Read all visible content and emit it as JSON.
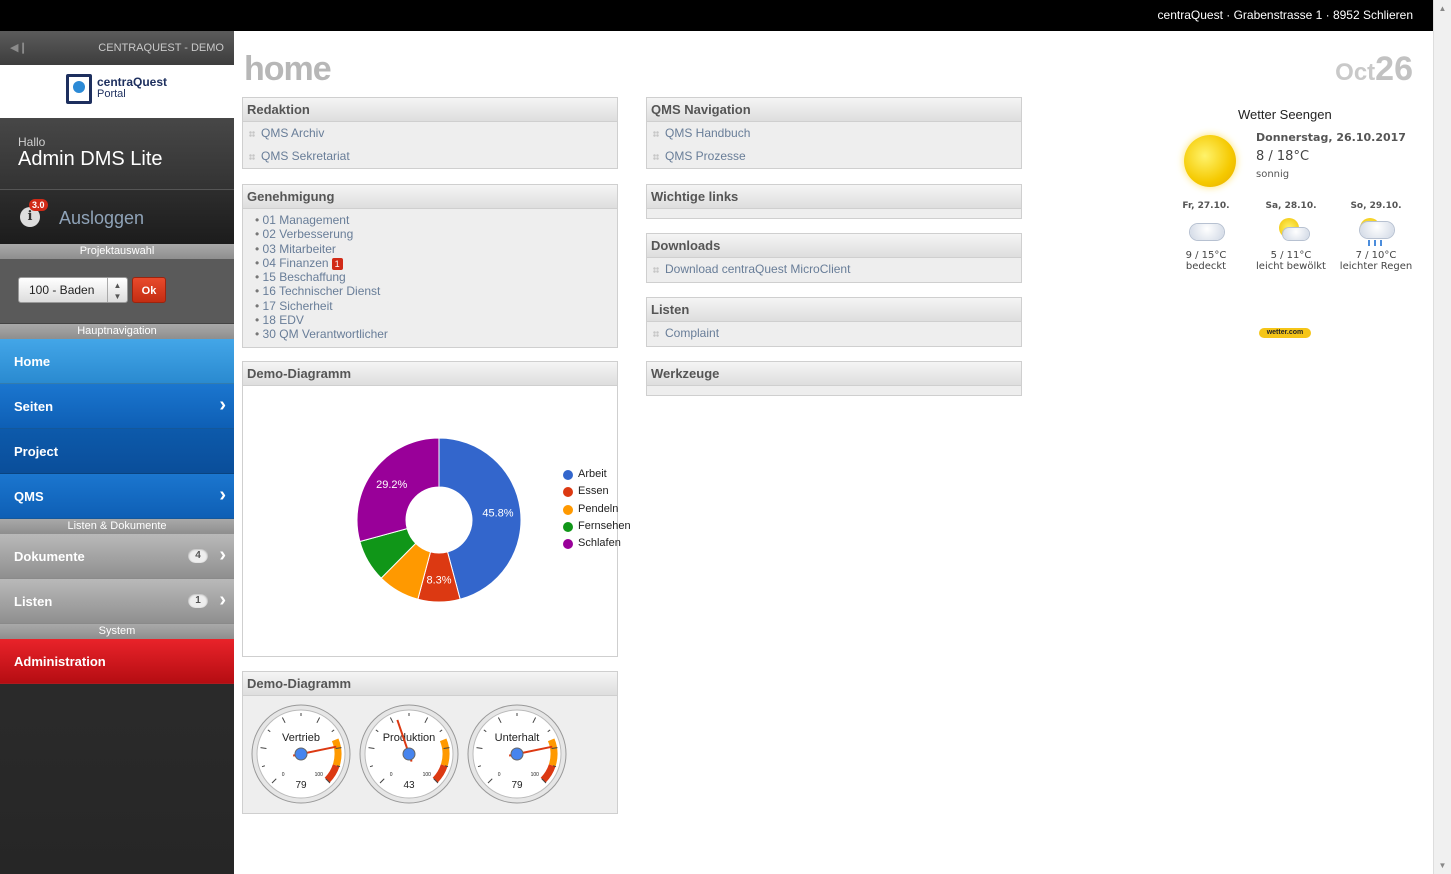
{
  "topbar": {
    "address": "centraQuest · Grabenstrasse 1 · 8952 Schlieren"
  },
  "sidebar": {
    "demo_label": "CENTRAQUEST - DEMO",
    "logo_line1": "centraQuest",
    "logo_line2": "Portal",
    "greeting": "Hallo",
    "user_name": "Admin DMS Lite",
    "version_badge": "3.0",
    "logout_label": "Ausloggen",
    "project_section": "Projektauswahl",
    "project_selected": "100 - Baden",
    "ok_label": "Ok",
    "main_nav_section": "Hauptnavigation",
    "main_nav": [
      {
        "label": "Home"
      },
      {
        "label": "Seiten"
      },
      {
        "label": "Project"
      },
      {
        "label": "QMS"
      }
    ],
    "lists_section": "Listen & Dokumente",
    "lists_nav": [
      {
        "label": "Dokumente",
        "count": "4"
      },
      {
        "label": "Listen",
        "count": "1"
      }
    ],
    "system_section": "System",
    "system_nav": [
      {
        "label": "Administration"
      }
    ]
  },
  "page": {
    "title": "home",
    "month": "Oct",
    "day": "26"
  },
  "panels": {
    "redaktion": {
      "title": "Redaktion",
      "links": [
        "QMS Archiv",
        "QMS Sekretariat"
      ]
    },
    "genehmigung": {
      "title": "Genehmigung",
      "items": [
        "01 Management",
        "02 Verbesserung",
        "03 Mitarbeiter",
        "04 Finanzen",
        "15 Beschaffung",
        "16 Technischer Dienst",
        "17 Sicherheit",
        "18 EDV",
        "30 QM Verantwortlicher"
      ],
      "finanzen_badge": "1"
    },
    "diagram1": {
      "title": "Demo-Diagramm"
    },
    "diagram2": {
      "title": "Demo-Diagramm"
    },
    "qms_nav": {
      "title": "QMS Navigation",
      "links": [
        "QMS Handbuch",
        "QMS Prozesse"
      ]
    },
    "wichtige": {
      "title": "Wichtige links"
    },
    "downloads": {
      "title": "Downloads",
      "links": [
        "Download centraQuest MicroClient"
      ]
    },
    "listen": {
      "title": "Listen",
      "links": [
        "Complaint"
      ]
    },
    "werkzeuge": {
      "title": "Werkzeuge"
    }
  },
  "chart_data": [
    {
      "type": "pie",
      "title": "Demo-Diagramm",
      "categories": [
        "Arbeit",
        "Essen",
        "Pendeln",
        "Fernsehen",
        "Schlafen"
      ],
      "values": [
        45.8,
        8.3,
        8.3,
        8.3,
        29.2
      ],
      "labels_shown": [
        "45.8%",
        "8.3%",
        "",
        "",
        "29.2%"
      ],
      "colors": [
        "#3366cc",
        "#dc3912",
        "#ff9900",
        "#109618",
        "#990099"
      ],
      "donut": true,
      "legend": "right"
    },
    {
      "type": "gauge",
      "title": "Demo-Diagramm",
      "min": 0,
      "max": 100,
      "gauges": [
        {
          "name": "Vertrieb",
          "value": 79
        },
        {
          "name": "Produktion",
          "value": 43
        },
        {
          "name": "Unterhalt",
          "value": 79
        }
      ]
    }
  ],
  "weather": {
    "title": "Wetter Seengen",
    "today_date": "Donnerstag, 26.10.2017",
    "today_temp": "8 / 18°C",
    "today_desc": "sonnig",
    "forecast": [
      {
        "day": "Fr, 27.10.",
        "temp": "9 / 15°C",
        "desc": "bedeckt",
        "icon": "cloud-icon"
      },
      {
        "day": "Sa, 28.10.",
        "temp": "5 / 11°C",
        "desc": "leicht bewölkt",
        "icon": "sun-cloud-icon"
      },
      {
        "day": "So, 29.10.",
        "temp": "7 / 10°C",
        "desc": "leichter Regen",
        "icon": "rain-icon"
      }
    ],
    "provider": "wetter.com"
  }
}
